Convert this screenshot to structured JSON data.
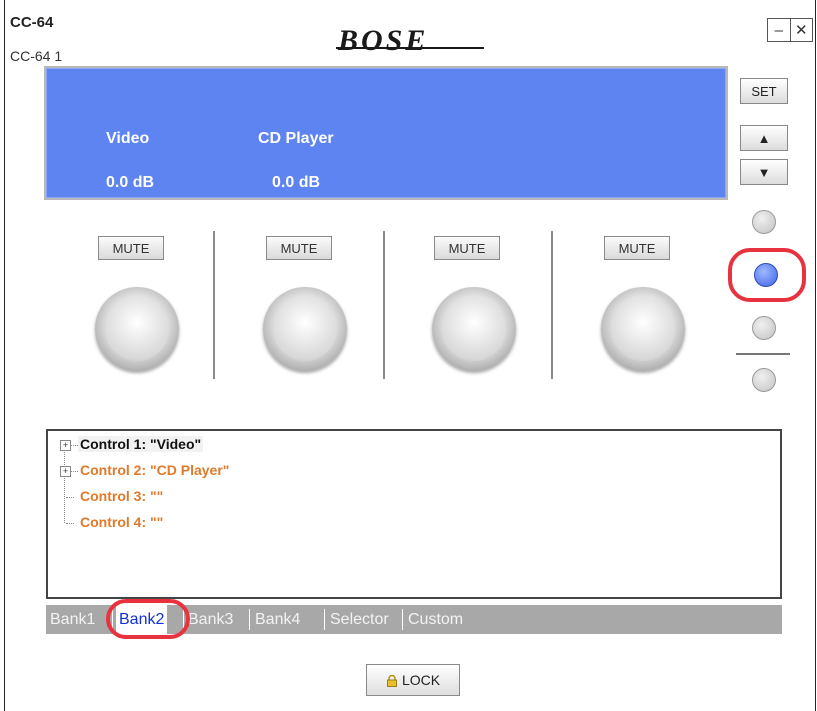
{
  "window": {
    "title": "CC-64",
    "subtitle": "CC-64 1",
    "brand": "BOSE",
    "minimize_glyph": "–",
    "close_glyph": "✕"
  },
  "display": {
    "channels": [
      {
        "name": "Video",
        "level": "0.0 dB"
      },
      {
        "name": "CD Player",
        "level": "0.0 dB"
      }
    ],
    "background_color": "#5d84f1"
  },
  "side": {
    "set_label": "SET",
    "up_glyph": "▲",
    "down_glyph": "▼",
    "bank_indicators": [
      "off",
      "on",
      "off",
      "off"
    ]
  },
  "channels": [
    {
      "mute_label": "MUTE"
    },
    {
      "mute_label": "MUTE"
    },
    {
      "mute_label": "MUTE"
    },
    {
      "mute_label": "MUTE"
    }
  ],
  "tree": {
    "items": [
      {
        "label": "Control 1: \"Video\"",
        "expander": "+",
        "selected": true
      },
      {
        "label": "Control 2: \"CD Player\"",
        "expander": "+",
        "selected": false
      },
      {
        "label": "Control 3: \"\"",
        "selected": false
      },
      {
        "label": "Control 4: \"\"",
        "selected": false
      }
    ]
  },
  "tabs": [
    {
      "label": "Bank1",
      "active": false
    },
    {
      "label": "Bank2",
      "active": true
    },
    {
      "label": "Bank3",
      "active": false
    },
    {
      "label": "Bank4",
      "active": false
    },
    {
      "label": "Selector",
      "active": false
    },
    {
      "label": "Custom",
      "active": false
    }
  ],
  "lock": {
    "label": "LOCK",
    "icon": "padlock-icon"
  },
  "colors": {
    "highlight": "#e8323e",
    "active_tab_text": "#1230d8",
    "tree_item_text": "#e07a2a"
  }
}
